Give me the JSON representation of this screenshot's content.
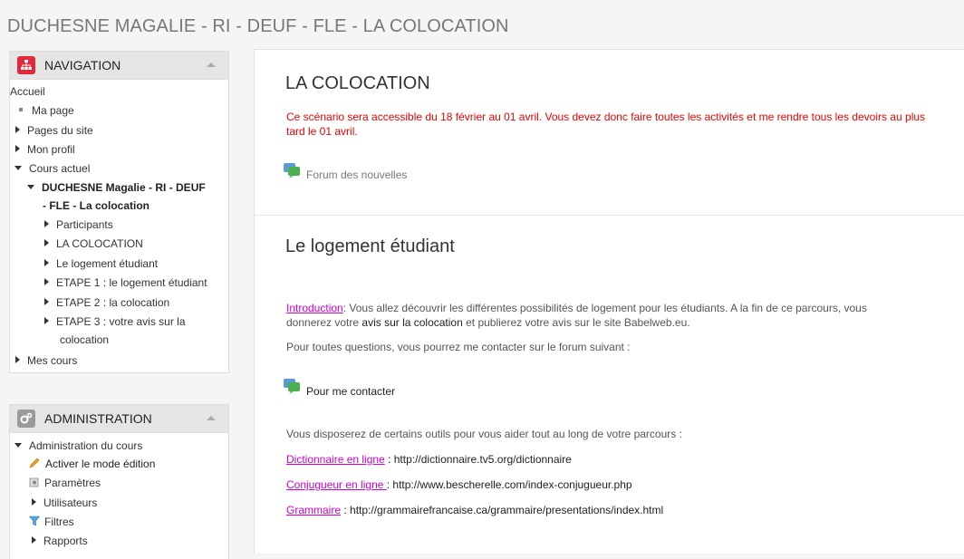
{
  "page_title": "DUCHESNE MAGALIE - RI - DEUF - FLE - LA COLOCATION",
  "navigation": {
    "title": "NAVIGATION",
    "home": "Accueil",
    "my_page": "Ma page",
    "site_pages": "Pages du site",
    "my_profile": "Mon profil",
    "current_course": "Cours actuel",
    "course_name_line1": "DUCHESNE Magalie - RI - DEUF",
    "course_name_line2": "- FLE - La colocation",
    "course_items": [
      "Participants",
      "LA COLOCATION",
      "Le logement étudiant",
      "ETAPE 1 : le logement étudiant",
      "ETAPE 2 : la colocation",
      "ETAPE 3 : votre avis sur la"
    ],
    "course_item_cont": "colocation",
    "my_courses": "Mes cours"
  },
  "administration": {
    "title": "ADMINISTRATION",
    "course_admin": "Administration du cours",
    "items": [
      "Activer le mode édition",
      "Paramètres",
      "Utilisateurs",
      "Filtres",
      "Rapports"
    ]
  },
  "section1": {
    "title": "LA COLOCATION",
    "notice_line1": "Ce scénario sera accessible du 18 février au 01 avril. Vous devez donc faire toutes les activités et me rendre tous les devoirs au plus",
    "notice_line2": "tard le 01 avril.",
    "forum": "Forum des nouvelles"
  },
  "section2": {
    "title": "Le logement étudiant",
    "intro_link": "Introduction",
    "intro_text1": ": Vous allez découvrir les différentes possibilités de logement pour les étudiants. A la fin de ce parcours, vous",
    "intro_text2a": "donnerez votre ",
    "intro_text2b": "avis sur la colocation",
    "intro_text2c": " et publierez votre avis sur le site Babelweb.eu.",
    "questions": "Pour toutes questions, vous pourrez me contacter sur le forum suivant :",
    "contact": "Pour me contacter",
    "tools": "Vous disposerez de certains outils pour vous aider tout au long de votre parcours :",
    "dict_link": "Dictionnaire en ligne",
    "dict_url": " : http://dictionnaire.tv5.org/dictionnaire",
    "conj_link": "Conjugueur en ligne ",
    "conj_url": ": http://www.bescherelle.com/index-conjugueur.php",
    "gram_link": "Grammaire",
    "gram_url": " : http://grammairefrancaise.ca/grammaire/presentations/index.html"
  },
  "colors": {
    "notice": "#ee0000",
    "link": "#d000d0",
    "nav_icon": "#e4283a",
    "admin_icon": "#9a9a9a"
  }
}
